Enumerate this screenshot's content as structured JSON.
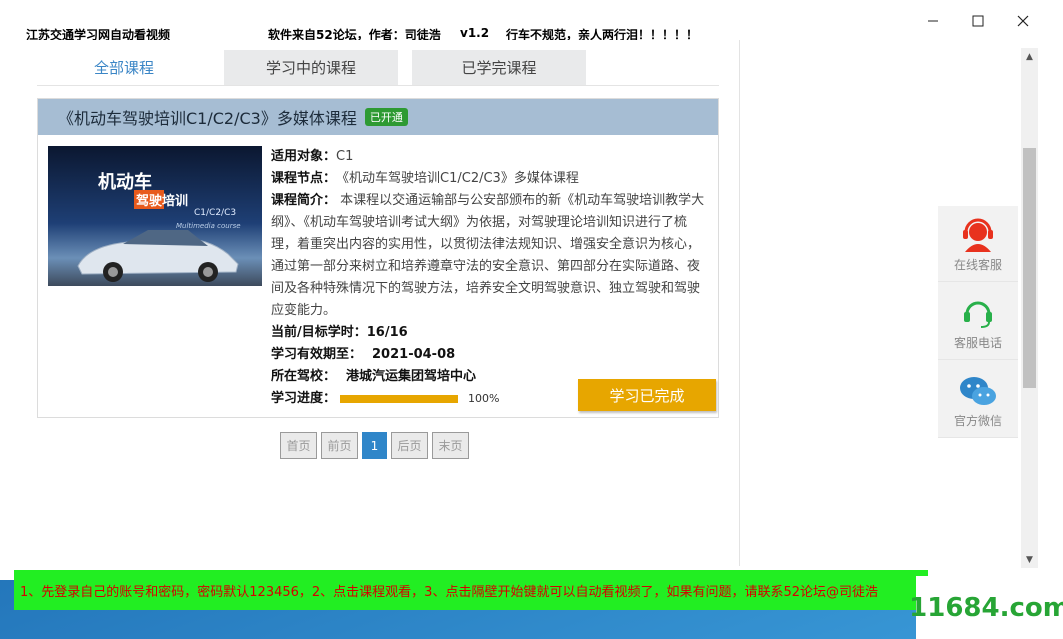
{
  "titlebar": {
    "app_name": "江苏交通学习网自动看视频",
    "source": "软件来自52论坛，作者：司徒浩",
    "version": "v1.2",
    "slogan": "行车不规范，亲人两行泪！！！！！"
  },
  "tabs": [
    {
      "label": "全部课程"
    },
    {
      "label": "学习中的课程"
    },
    {
      "label": "已学完课程"
    }
  ],
  "course": {
    "title": "《机动车驾驶培训C1/C2/C3》多媒体课程",
    "badge": "已开通",
    "thumb": {
      "line1": "机动车",
      "line2": "驾驶培训",
      "line3": "C1/C2/C3",
      "line4": "Multimedia course"
    },
    "audience_label": "适用对象：",
    "audience": "C1",
    "node_label": "课程节点：",
    "node": "《机动车驾驶培训C1/C2/C3》多媒体课程",
    "intro_label": "课程简介：",
    "intro": "本课程以交通运输部与公安部颁布的新《机动车驾驶培训教学大纲》、《机动车驾驶培训考试大纲》为依据，对驾驶理论培训知识进行了梳理，着重突出内容的实用性，以贯彻法律法规知识、增强安全意识为核心，通过第一部分来树立和培养遵章守法的安全意识、第四部分在实际道路、夜间及各种特殊情况下的驾驶方法，培养安全文明驾驶意识、独立驾驶和驾驶应变能力。",
    "hours_label": "当前/目标学时：",
    "hours": "16/16",
    "expire_label": "学习有效期至：",
    "expire": "2021-04-08",
    "school_label": "所在驾校：",
    "school": "港城汽运集团驾培中心",
    "progress_label": "学习进度：",
    "progress_text": "100%",
    "progress_value": 1.0,
    "status_button": "学习已完成"
  },
  "pager": {
    "first": "首页",
    "prev": "前页",
    "current": "1",
    "next": "后页",
    "last": "末页"
  },
  "sidebar": [
    {
      "label": "在线客服",
      "icon": "headset-agent-icon"
    },
    {
      "label": "客服电话",
      "icon": "phone-headset-icon"
    },
    {
      "label": "官方微信",
      "icon": "wechat-icon"
    }
  ],
  "notice": "1、先登录自己的账号和密码，密码默认123456，2、点击课程观看，3、点击隔壁开始键就可以自动看视频了，如果有问题，请联系52论坛@司徒浩",
  "watermark": "11684.com",
  "colors": {
    "accent": "#3b86c6",
    "header_bar": "#a6bdd3",
    "badge": "#2e9a33",
    "progress": "#e7a600",
    "notice_bg": "#22ee22",
    "notice_text": "#d60000",
    "watermark": "#27a535"
  }
}
